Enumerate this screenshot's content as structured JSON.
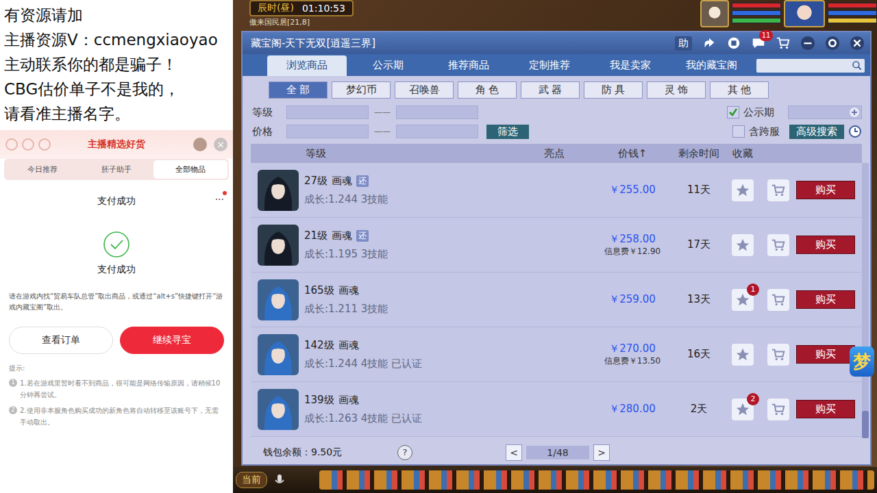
{
  "overlay_notice": {
    "lines": [
      "有资源请加",
      "主播资源V：ccmengxiaoyao",
      "主动联系你的都是骗子！",
      "CBG估价单子不是我的，",
      "请看准主播名字。"
    ]
  },
  "shop_panel": {
    "title": "主播精选好货",
    "close": "×",
    "tabs": [
      {
        "label": "今日推荐",
        "selected": false
      },
      {
        "label": "胚子助手",
        "selected": false
      },
      {
        "label": "全部物品",
        "selected": true
      }
    ]
  },
  "payment": {
    "title": "支付成功",
    "more": "···",
    "has_alert": true,
    "status": "支付成功",
    "message": "请在游戏内找“贸易车队总管”取出商品，或通过“alt+s”快捷键打开“游戏内藏宝阁”取出。",
    "buttons": [
      {
        "label": "查看订单",
        "primary": false
      },
      {
        "label": "继续寻宝",
        "primary": true
      }
    ],
    "tips_title": "提示:",
    "tips": [
      {
        "num": "1",
        "text": "1.若在游戏里暂时看不到商品，很可能是网络传输原因，请稍候10分钟再尝试。"
      },
      {
        "num": "2",
        "text": "2.使用非本服角色购买成功的新角色将自动转移至该账号下，无需手动取出。"
      }
    ]
  },
  "game_hud": {
    "time_label": "辰时(昼)",
    "clock": "01:10:53",
    "location": "傲来国民居[21,8]"
  },
  "window": {
    "title": "藏宝阁-天下无双[逍遥三界]",
    "help": "助",
    "chat_badge": "11",
    "tabs": [
      {
        "label": "浏览商品",
        "selected": true
      },
      {
        "label": "公示期",
        "selected": false
      },
      {
        "label": "推荐商品",
        "selected": false
      },
      {
        "label": "定制推荐",
        "selected": false
      },
      {
        "label": "我是卖家",
        "selected": false
      },
      {
        "label": "我的藏宝阁",
        "selected": false
      }
    ],
    "search": {
      "placeholder": ""
    },
    "categories": [
      {
        "label": "全 部",
        "selected": true
      },
      {
        "label": "梦幻币",
        "selected": false
      },
      {
        "label": "召唤兽",
        "selected": false
      },
      {
        "label": "角 色",
        "selected": false
      },
      {
        "label": "武 器",
        "selected": false
      },
      {
        "label": "防 具",
        "selected": false
      },
      {
        "label": "灵 饰",
        "selected": false
      },
      {
        "label": "其 他",
        "selected": false
      }
    ],
    "filters": {
      "level_label": "等级",
      "price_label": "价格",
      "dash": "——",
      "filter_button": "筛选",
      "public": {
        "label": "公示期",
        "checked": true
      },
      "cross_server": {
        "label": "含跨服",
        "checked": false
      },
      "advanced": "高级搜索"
    }
  },
  "table": {
    "columns": {
      "level": "等级",
      "highlight": "亮点",
      "price": "价钱↑",
      "remaining": "剩余时间",
      "favorite": "收藏"
    },
    "rows": [
      {
        "kind": "dark",
        "level": "27级",
        "name": "画魂",
        "tag": "还",
        "growth": "成长:1.244 3技能",
        "price": "￥255.00",
        "fee": "",
        "days": "11天",
        "fav_badge": "",
        "buy": "购买"
      },
      {
        "kind": "dark",
        "level": "21级",
        "name": "画魂",
        "tag": "还",
        "growth": "成长:1.195 3技能",
        "price": "￥258.00",
        "fee": "信息费￥12.90",
        "days": "17天",
        "fav_badge": "",
        "buy": "购买"
      },
      {
        "kind": "blue",
        "level": "165级",
        "name": "画魂",
        "tag": "",
        "growth": "成长:1.211 3技能",
        "price": "￥259.00",
        "fee": "",
        "days": "13天",
        "fav_badge": "1",
        "buy": "购买"
      },
      {
        "kind": "blue",
        "level": "142级",
        "name": "画魂",
        "tag": "",
        "growth": "成长:1.244 4技能 已认证",
        "price": "￥270.00",
        "fee": "信息费￥13.50",
        "days": "16天",
        "fav_badge": "",
        "buy": "购买"
      },
      {
        "kind": "blue",
        "level": "139级",
        "name": "画魂",
        "tag": "",
        "growth": "成长:1.263 4技能 已认证",
        "price": "￥280.00",
        "fee": "",
        "days": "2天",
        "fav_badge": "2",
        "buy": "购买"
      }
    ]
  },
  "footer": {
    "wallet": "钱包余额：9.50元",
    "help": "?",
    "prev": "<",
    "page": "1/48",
    "next": ">"
  },
  "bottom_bar": {
    "current": "当前"
  },
  "floating_logo": "梦"
}
